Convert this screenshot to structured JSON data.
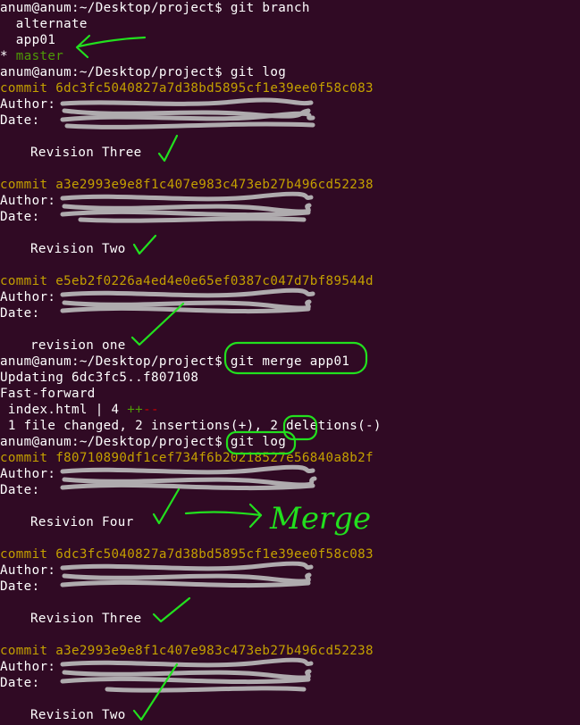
{
  "terminal": {
    "prompt": "anum@anum:~/Desktop/project$",
    "cmd_branch": " git branch",
    "branches": [
      "  alternate",
      "  app01"
    ],
    "current_star": "* ",
    "current_branch": "master",
    "cmd_log": " git log",
    "commit1_hash": "commit 6dc3fc5040827a7d38bd5895cf1e39ee0f58c083",
    "author_label": "Author:",
    "date_label": "Date:",
    "msg_three": "Revision Three",
    "commit2_hash": "commit a3e2993e9e8f1c407e983c473eb27b496cd52238",
    "msg_two": "Revision Two",
    "commit3_hash": "commit e5eb2f0226a4ed4e0e65ef0387c047d7bf89544d",
    "msg_one": "revision one",
    "cmd_merge": " git merge app01",
    "updating": "Updating 6dc3fc5..f807108",
    "fast_forward": "Fast-forward",
    "diff_file": " index.html | 4 ",
    "diff_plus": "++",
    "diff_minus": "--",
    "summary": " 1 file changed, 2 insertions(+), 2 deletions(-)",
    "cmd_log2": " git log",
    "commit4_hash": "commit f80710890df1cef734f6b2021852​7e56840a8b2f",
    "msg_four": "Resivion Four",
    "commit5_hash": "commit 6dc3fc5040827a7d38bd5895cf1e39ee0f58c083",
    "commit6_hash": "commit a3e2993e9e8f1c407e983c473eb27b496cd52238"
  },
  "annotation": {
    "merge_label": "Merge"
  },
  "colors": {
    "background": "#300a24",
    "commit_yellow": "#c4a000",
    "branch_green": "#4e9a06",
    "annotation_green": "#22e01e"
  }
}
